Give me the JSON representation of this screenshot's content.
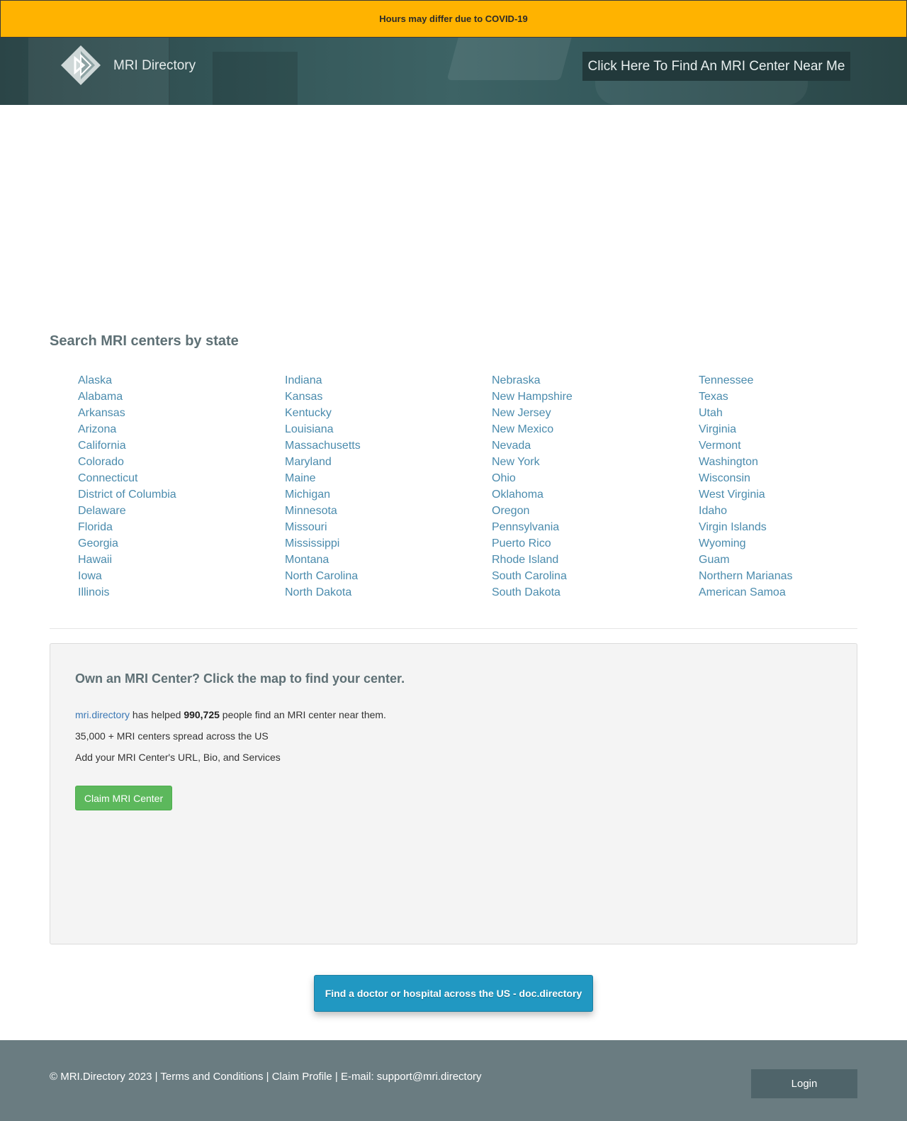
{
  "banner": {
    "text": "Hours may differ due to COVID-19"
  },
  "header": {
    "brand": "MRI Directory",
    "find_button": "Click Here To Find An MRI Center Near Me",
    "logo_icon": "diamond-logo-icon"
  },
  "states_section": {
    "title": "Search MRI centers by state",
    "columns": [
      [
        "Alaska",
        "Alabama",
        "Arkansas",
        "Arizona",
        "California",
        "Colorado",
        "Connecticut",
        "District of Columbia",
        "Delaware",
        "Florida",
        "Georgia",
        "Hawaii",
        "Iowa",
        "Illinois"
      ],
      [
        "Indiana",
        "Kansas",
        "Kentucky",
        "Louisiana",
        "Massachusetts",
        "Maryland",
        "Maine",
        "Michigan",
        "Minnesota",
        "Missouri",
        "Mississippi",
        "Montana",
        "North Carolina",
        "North Dakota"
      ],
      [
        "Nebraska",
        "New Hampshire",
        "New Jersey",
        "New Mexico",
        "Nevada",
        "New York",
        "Ohio",
        "Oklahoma",
        "Oregon",
        "Pennsylvania",
        "Puerto Rico",
        "Rhode Island",
        "South Carolina",
        "South Dakota"
      ],
      [
        "Tennessee",
        "Texas",
        "Utah",
        "Virginia",
        "Vermont",
        "Washington",
        "Wisconsin",
        "West Virginia",
        "Idaho",
        "Virgin Islands",
        "Wyoming",
        "Guam",
        "Northern Marianas",
        "American Samoa"
      ]
    ]
  },
  "claim": {
    "title": "Own an MRI Center? Click the map to find your center.",
    "line1_link": "mri.directory",
    "line1_pre": " has helped ",
    "line1_count": "990,725",
    "line1_post": " people find an MRI center near them.",
    "line2": "35,000 + MRI centers spread across the US",
    "line3": "Add your MRI Center's URL, Bio, and Services",
    "button": "Claim MRI Center"
  },
  "doc_button": "Find a doctor or hospital across the US - doc.directory",
  "footer": {
    "text": "© MRI.Directory 2023 | Terms and Conditions | Claim Profile | E-mail: support@mri.directory",
    "login": "Login"
  },
  "colors": {
    "banner": "#ffb300",
    "header": "#2b4547",
    "link": "#4a8bad",
    "claim_button": "#5cb85c",
    "doc_button": "#2198c2",
    "footer": "#6a7c81"
  }
}
